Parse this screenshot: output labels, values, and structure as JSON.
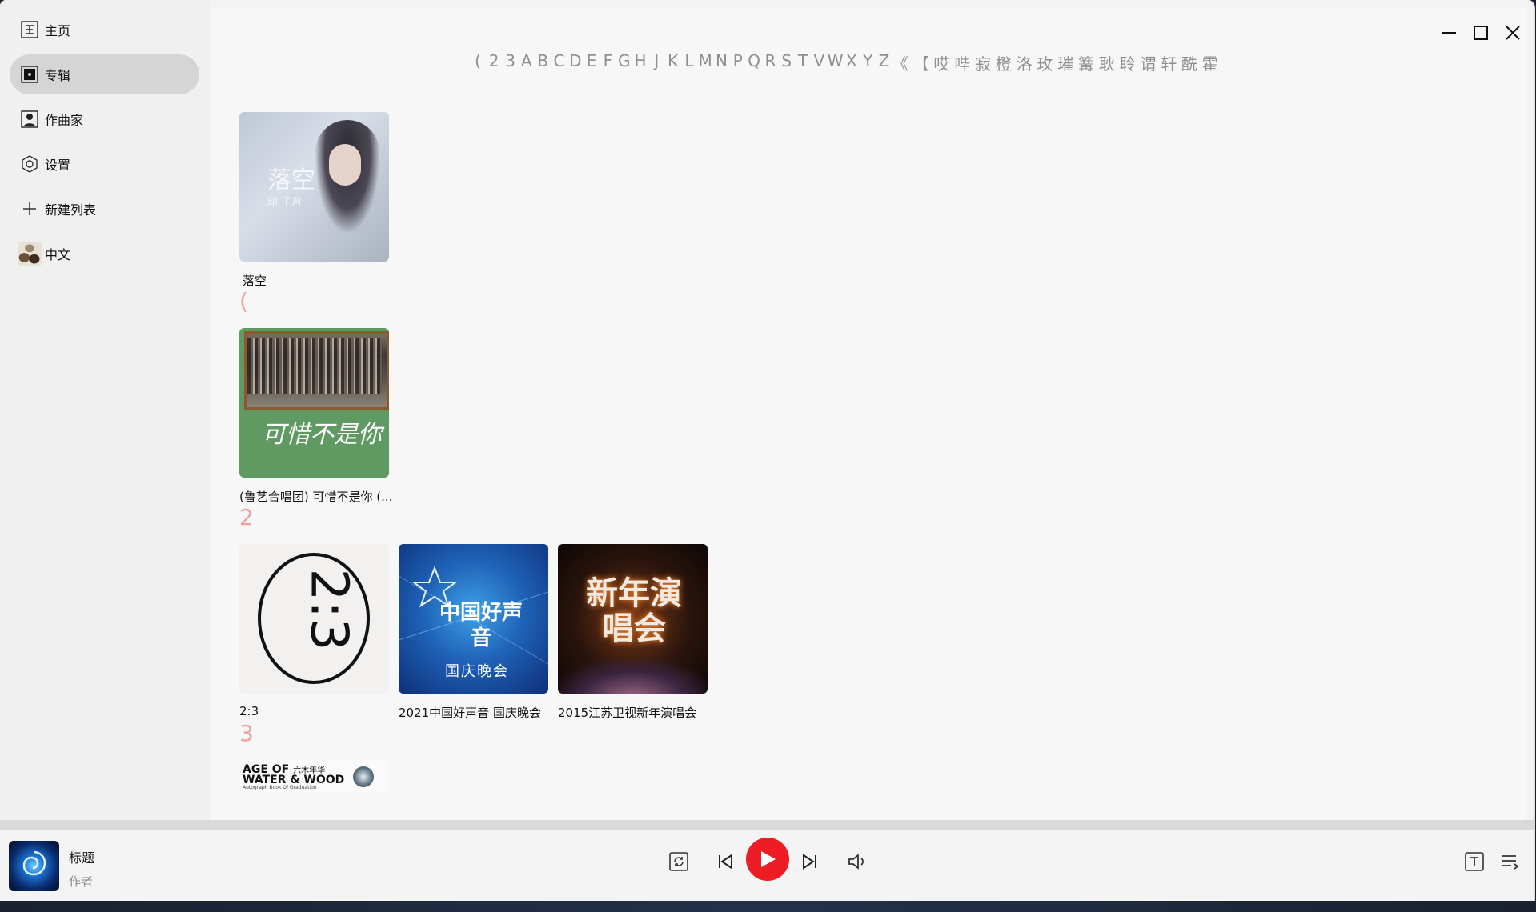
{
  "sidebar": {
    "items": [
      {
        "label": "主页",
        "icon": "home-icon"
      },
      {
        "label": "专辑",
        "icon": "album-icon",
        "active": true
      },
      {
        "label": "作曲家",
        "icon": "artist-icon"
      },
      {
        "label": "设置",
        "icon": "settings-icon"
      },
      {
        "label": "新建列表",
        "icon": "plus-icon"
      },
      {
        "label": "中文",
        "icon": "playlist-avatar-icon"
      }
    ]
  },
  "alphabet_index": [
    "(",
    "2",
    "3",
    "A",
    "B",
    "C",
    "D",
    "E",
    "F",
    "G",
    "H",
    "J",
    "K",
    "L",
    "M",
    "N",
    "P",
    "Q",
    "R",
    "S",
    "T",
    "V",
    "W",
    "X",
    "Y",
    "Z",
    "《",
    "【",
    "哎",
    "哔",
    "寂",
    "橙",
    "洛",
    "玫",
    "璀",
    "篝",
    "耿",
    "聆",
    "谓",
    "轩",
    "酰",
    "霍"
  ],
  "groups": [
    {
      "letter": "(",
      "albums": []
    },
    {
      "letter": "2",
      "albums": []
    },
    {
      "letter": "3",
      "albums": []
    }
  ],
  "albums": {
    "luokong": {
      "title": "落空",
      "cover_text": "落空",
      "cover_sub": "印 子月"
    },
    "luyi": {
      "title": "(鲁艺合唱团) 可惜不是你 (...",
      "cover_text": "可惜不是你"
    },
    "two_three": {
      "title": "2:3",
      "cover_text": "2:3"
    },
    "voice2021": {
      "title": "2021中国好声音 国庆晚会",
      "cover_text": "中国好声音",
      "cover_sub": "国庆晚会"
    },
    "jiangsu2015": {
      "title": "2015江苏卫视新年演唱会",
      "cover_text": "新年演唱会"
    },
    "age_of_water": {
      "cover_text_1": "AGE OF",
      "cover_text_1b": "六木年华",
      "cover_text_2": "WATER & WOOD",
      "cover_text_3": "Autograph Book Of Graduation"
    }
  },
  "group_letters": [
    "(",
    "2",
    "3"
  ],
  "player": {
    "title": "标题",
    "artist": "作者"
  },
  "colors": {
    "accent": "#ee1c25",
    "scrollbar": "#e8141e",
    "group_letter": "#f1a0a0"
  }
}
